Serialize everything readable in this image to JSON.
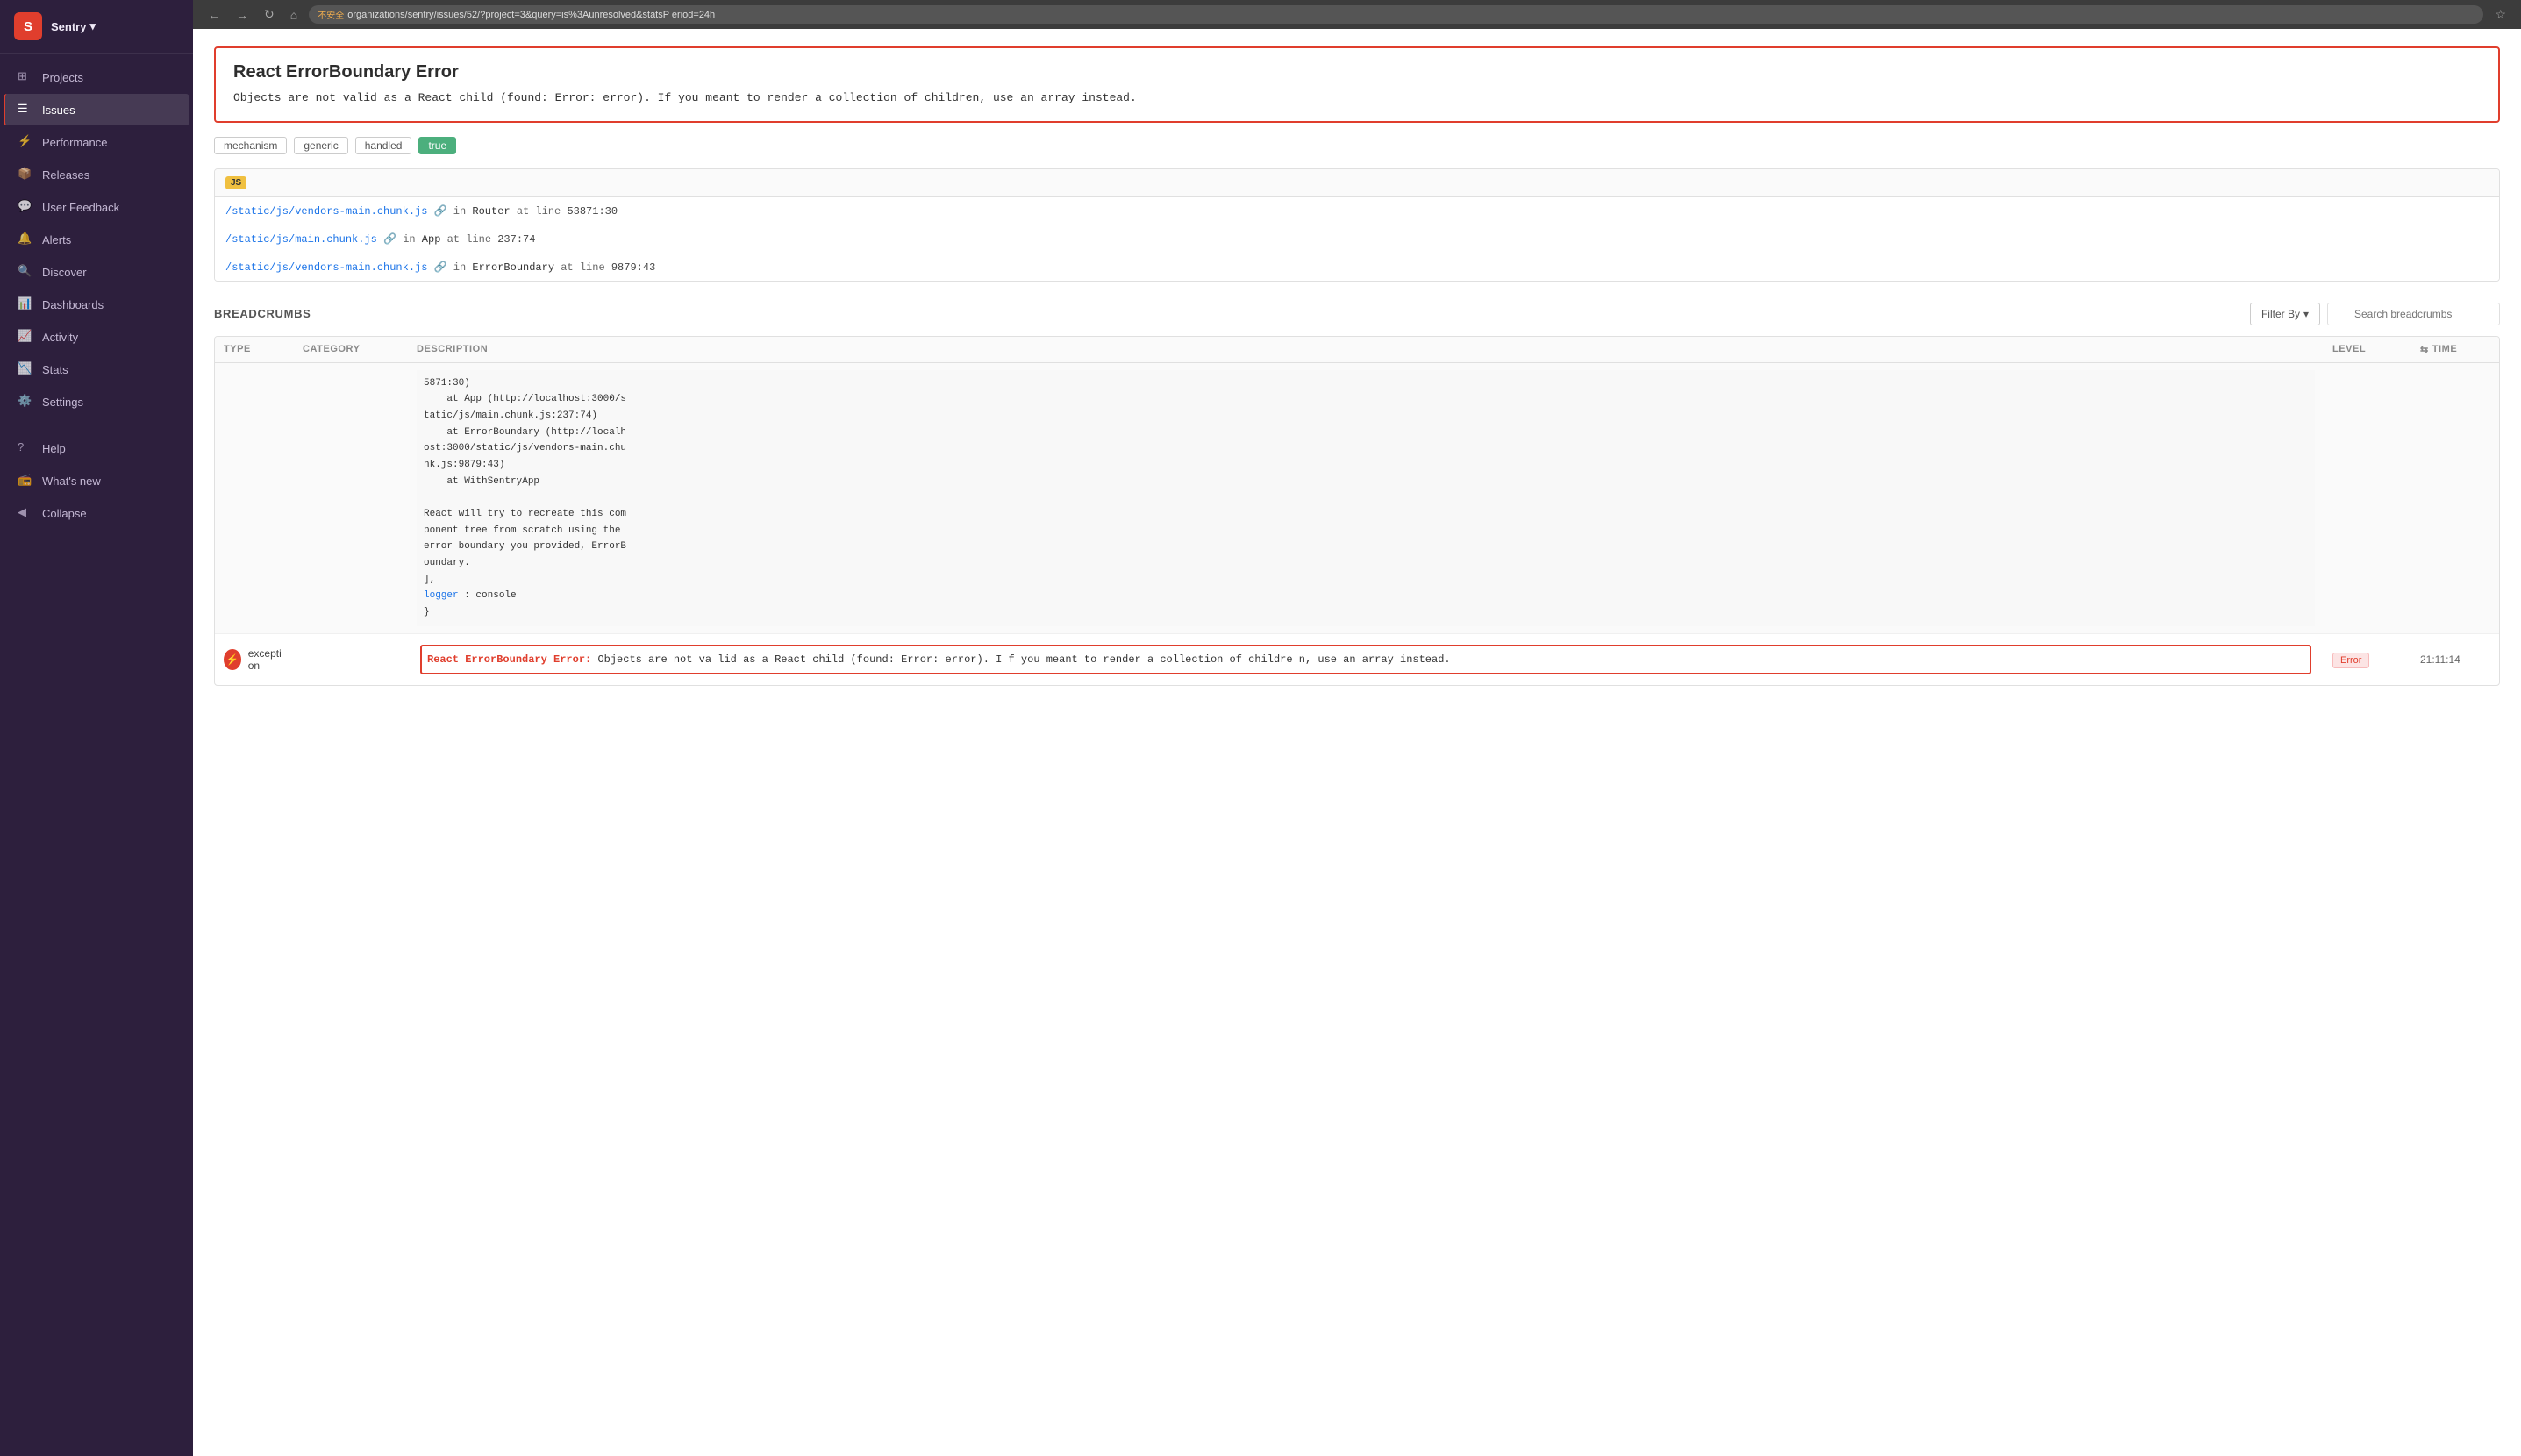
{
  "browser": {
    "url": "organizations/sentry/issues/52/?project=3&query=is%3Aunresolved&statsP eriod=24h",
    "warning": "不安全"
  },
  "sidebar": {
    "org": "Sentry",
    "logo": "S",
    "items": [
      {
        "id": "projects",
        "label": "Projects",
        "icon": "grid"
      },
      {
        "id": "issues",
        "label": "Issues",
        "icon": "list",
        "active": true
      },
      {
        "id": "performance",
        "label": "Performance",
        "icon": "lightning"
      },
      {
        "id": "releases",
        "label": "Releases",
        "icon": "box"
      },
      {
        "id": "user-feedback",
        "label": "User Feedback",
        "icon": "comment"
      },
      {
        "id": "alerts",
        "label": "Alerts",
        "icon": "bell"
      },
      {
        "id": "discover",
        "label": "Discover",
        "icon": "search"
      },
      {
        "id": "dashboards",
        "label": "Dashboards",
        "icon": "chart"
      },
      {
        "id": "activity",
        "label": "Activity",
        "icon": "activity"
      },
      {
        "id": "stats",
        "label": "Stats",
        "icon": "bar-chart"
      },
      {
        "id": "settings",
        "label": "Settings",
        "icon": "gear"
      }
    ],
    "footer": [
      {
        "id": "help",
        "label": "Help",
        "icon": "help"
      },
      {
        "id": "whats-new",
        "label": "What's new",
        "icon": "radio"
      },
      {
        "id": "collapse",
        "label": "Collapse",
        "icon": "collapse"
      }
    ]
  },
  "error": {
    "title": "React ErrorBoundary Error",
    "message": "Objects are not valid as a React child (found: Error: error). If you meant to render a collection of\nchildren, use an array instead.",
    "tags": [
      {
        "label": "mechanism",
        "active": false
      },
      {
        "label": "generic",
        "active": false
      },
      {
        "label": "handled",
        "active": false
      },
      {
        "label": "true",
        "active": true
      }
    ]
  },
  "stack": {
    "badge": "JS",
    "frames": [
      {
        "file": "/static/js/vendors-main.chunk.js",
        "context": "in",
        "component": "Router",
        "location": "at line",
        "line": "53871:30"
      },
      {
        "file": "/static/js/main.chunk.js",
        "context": "in",
        "component": "App",
        "location": "at line",
        "line": "237:74"
      },
      {
        "file": "/static/js/vendors-main.chunk.js",
        "context": "in",
        "component": "ErrorBoundary",
        "location": "at line",
        "line": "9879:43"
      }
    ]
  },
  "breadcrumbs": {
    "title": "BREADCRUMBS",
    "filter_label": "Filter By",
    "search_placeholder": "Search breadcrumbs",
    "columns": [
      "TYPE",
      "CATEGORY",
      "DESCRIPTION",
      "LEVEL",
      "TIME"
    ],
    "code_block": {
      "lines": [
        "5871:30)",
        "    at App (http://localhost:3000/s",
        "tatic/js/main.chunk.js:237:74)",
        "    at ErrorBoundary (http://localh",
        "ost:3000/static/js/vendors-main.chu",
        "nk.js:9879:43)",
        "    at WithSentryApp",
        "",
        "React will try to recreate this com",
        "ponent tree from scratch using the",
        "error boundary you provided, ErrorB",
        "oundary.",
        "],",
        "logger:  console",
        "}"
      ],
      "logger_key": "logger"
    },
    "exception": {
      "type": "exception",
      "title": "React ErrorBoundary Error:",
      "message": "Objects are not va lid as a React child (found: Error: error). I f you meant to render a collection of childre n, use an array instead.",
      "level": "Error",
      "time": "21:11:14"
    }
  }
}
